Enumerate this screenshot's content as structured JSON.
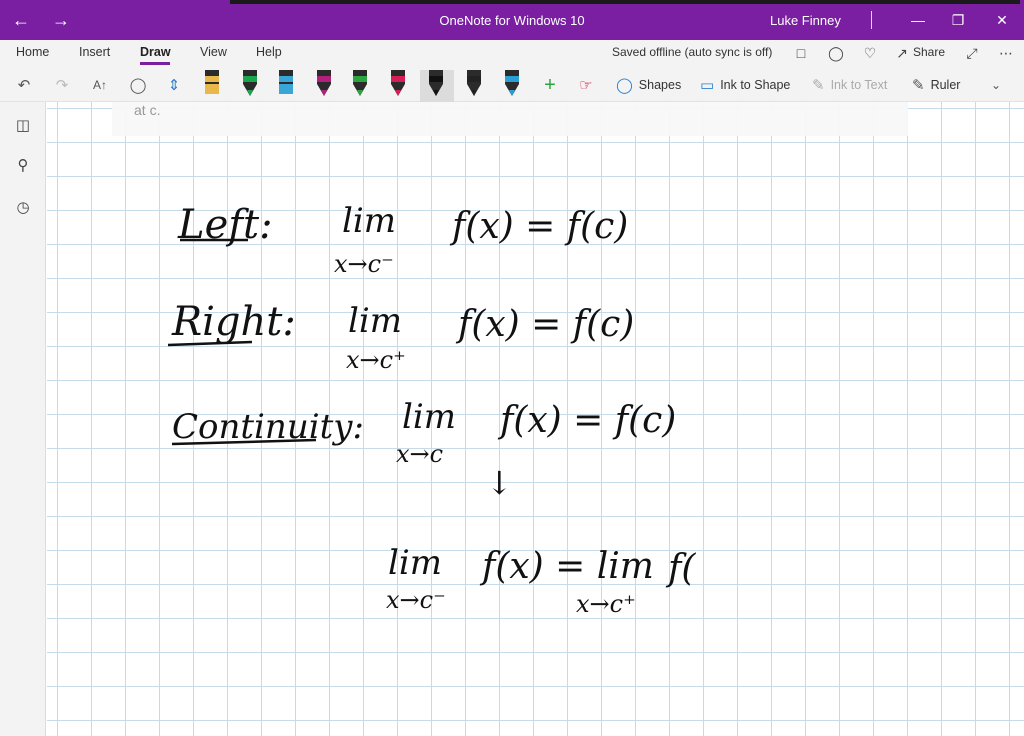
{
  "titlebar": {
    "back_icon": "back-arrow-icon",
    "forward_icon": "forward-arrow-icon",
    "title": "OneNote for Windows 10",
    "user": "Luke Finney"
  },
  "menu": {
    "tabs": [
      "Home",
      "Insert",
      "Draw",
      "View",
      "Help"
    ],
    "active": "Draw",
    "status": "Saved offline (auto sync is off)",
    "share": "Share"
  },
  "toolbar": {
    "shapes": "Shapes",
    "ink_to_shape": "Ink to Shape",
    "ink_to_text": "Ink to Text",
    "ruler": "Ruler",
    "pens": [
      {
        "color": "#e8b84a",
        "kind": "highlighter"
      },
      {
        "color": "#1aa64a",
        "kind": "pen"
      },
      {
        "color": "#3aa6d8",
        "kind": "highlighter"
      },
      {
        "color": "#b2207c",
        "kind": "pen"
      },
      {
        "color": "#2aa53f",
        "kind": "pen"
      },
      {
        "color": "#d61e56",
        "kind": "pen"
      },
      {
        "color": "#111111",
        "kind": "pen-selected"
      },
      {
        "color": "#222222",
        "kind": "pen"
      },
      {
        "color": "#2a9fd6",
        "kind": "pen"
      }
    ]
  },
  "note": {
    "text": "at c."
  },
  "ink": {
    "left_label": "Left:",
    "left_lim": "lim",
    "left_sub": "x→c⁻",
    "left_expr": "f(x) = f(c)",
    "right_label": "Right:",
    "right_lim": "lim",
    "right_sub": "x→c⁺",
    "right_expr": "f(x) = f(c)",
    "cont_label": "Continuity:",
    "cont_lim": "lim",
    "cont_sub": "x→c",
    "cont_expr": "f(x) = f(c)",
    "arrow": "↓",
    "bottom_lim1": "lim",
    "bottom_sub1": "x→c⁻",
    "bottom_mid": "f(x) = lim",
    "bottom_sub2": "x→c⁺",
    "bottom_end": "f("
  }
}
